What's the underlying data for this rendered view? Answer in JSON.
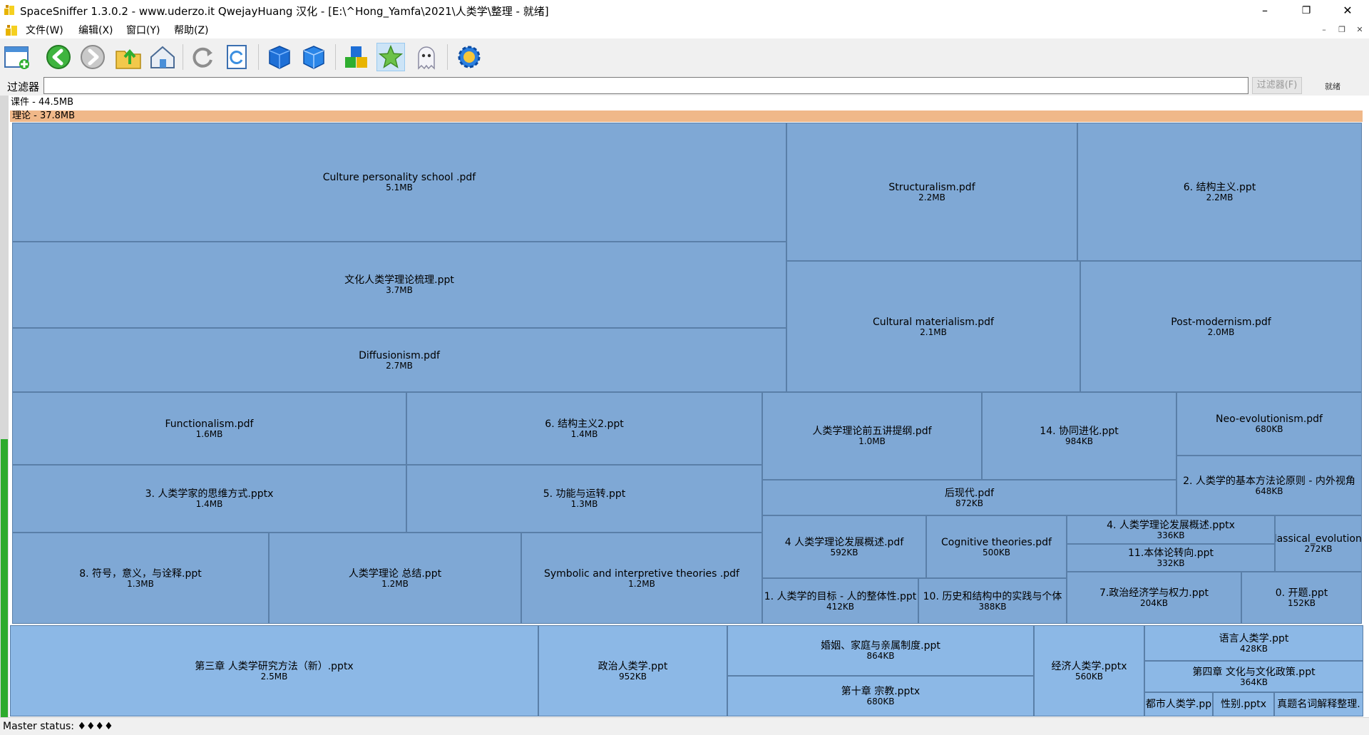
{
  "window": {
    "title": "SpaceSniffer 1.3.0.2 - www.uderzo.it  QwejayHuang 汉化 - [E:\\^Hong_Yamfa\\2021\\人类学\\整理 - 就绪]",
    "controls": {
      "minimize": "–",
      "restore": "❐",
      "close": "✕"
    }
  },
  "menu": {
    "items": [
      "文件(W)",
      "编辑(X)",
      "窗口(Y)",
      "帮助(Z)"
    ],
    "mdi_controls": {
      "minimize": "–",
      "restore": "❐",
      "close": "✕"
    }
  },
  "toolbar": {
    "icons": [
      "new-scan-icon",
      "back-icon",
      "forward-icon",
      "up-folder-icon",
      "home-icon",
      "refresh-icon",
      "refresh-all-icon",
      "zoom-in-cube-icon",
      "zoom-out-cube-icon",
      "blocks-icon",
      "favorite-star-icon",
      "ghost-icon",
      "settings-gear-icon"
    ]
  },
  "filter": {
    "label": "过滤器",
    "value": "",
    "button": "过滤器(F)",
    "status": "就绪"
  },
  "treemap": {
    "headers": [
      {
        "id": "courseware",
        "label": "课件 - 44.5MB"
      },
      {
        "id": "theory",
        "label": "理论 - 37.8MB"
      }
    ],
    "theory_files": [
      {
        "name": "Culture personality school .pdf",
        "size": "5.1MB"
      },
      {
        "name": "文化人类学理论梳理.ppt",
        "size": "3.7MB"
      },
      {
        "name": "Diffusionism.pdf",
        "size": "2.7MB"
      },
      {
        "name": "Structuralism.pdf",
        "size": "2.2MB"
      },
      {
        "name": "6. 结构主义.ppt",
        "size": "2.2MB"
      },
      {
        "name": "Cultural materialism.pdf",
        "size": "2.1MB"
      },
      {
        "name": "Post-modernism.pdf",
        "size": "2.0MB"
      },
      {
        "name": "Functionalism.pdf",
        "size": "1.6MB"
      },
      {
        "name": "6. 结构主义2.ppt",
        "size": "1.4MB"
      },
      {
        "name": "3. 人类学家的思维方式.pptx",
        "size": "1.4MB"
      },
      {
        "name": "5. 功能与运转.ppt",
        "size": "1.3MB"
      },
      {
        "name": "8. 符号，意义，与诠释.ppt",
        "size": "1.3MB"
      },
      {
        "name": "人类学理论 总结.ppt",
        "size": "1.2MB"
      },
      {
        "name": "Symbolic and interpretive theories .pdf",
        "size": "1.2MB"
      },
      {
        "name": "人类学理论前五讲提纲.pdf",
        "size": "1.0MB"
      },
      {
        "name": "14. 协同进化.ppt",
        "size": "984KB"
      },
      {
        "name": "Neo-evolutionism.pdf",
        "size": "680KB"
      },
      {
        "name": "后现代.pdf",
        "size": "872KB"
      },
      {
        "name": "2. 人类学的基本方法论原则 - 内外视角",
        "size": "648KB"
      },
      {
        "name": "4 人类学理论发展概述.pdf",
        "size": "592KB"
      },
      {
        "name": "Cognitive theories.pdf",
        "size": "500KB"
      },
      {
        "name": "4. 人类学理论发展概述.pptx",
        "size": "336KB"
      },
      {
        "name": "11.本体论转向.ppt",
        "size": "332KB"
      },
      {
        "name": "Classical_evolutionis",
        "size": "272KB"
      },
      {
        "name": "1. 人类学的目标 - 人的整体性.ppt",
        "size": "412KB"
      },
      {
        "name": "10. 历史和结构中的实践与个体",
        "size": "388KB"
      },
      {
        "name": "7.政治经济学与权力.ppt",
        "size": "204KB"
      },
      {
        "name": "0. 开题.ppt",
        "size": "152KB"
      }
    ],
    "courseware_files": [
      {
        "name": "第三章 人类学研究方法（新）.pptx",
        "size": "2.5MB"
      },
      {
        "name": "政治人类学.ppt",
        "size": "952KB"
      },
      {
        "name": "婚姻、家庭与亲属制度.ppt",
        "size": "864KB"
      },
      {
        "name": "第十章 宗教.pptx",
        "size": "680KB"
      },
      {
        "name": "经济人类学.pptx",
        "size": "560KB"
      },
      {
        "name": "语言人类学.ppt",
        "size": "428KB"
      },
      {
        "name": "第四章 文化与文化政策.ppt",
        "size": "364KB"
      },
      {
        "name": "都市人类学.pp",
        "size": ""
      },
      {
        "name": "性别.pptx",
        "size": ""
      },
      {
        "name": "真题名词解释整理.",
        "size": ""
      }
    ]
  },
  "status": {
    "text": "Master status: ♦♦♦♦"
  },
  "colors": {
    "theory_header": "#f0b889",
    "cell_dark": "#7fa8d5",
    "cell_light": "#8cb8e6",
    "cell_border": "#5a7fa8",
    "level_bar": "#2dab2d"
  }
}
